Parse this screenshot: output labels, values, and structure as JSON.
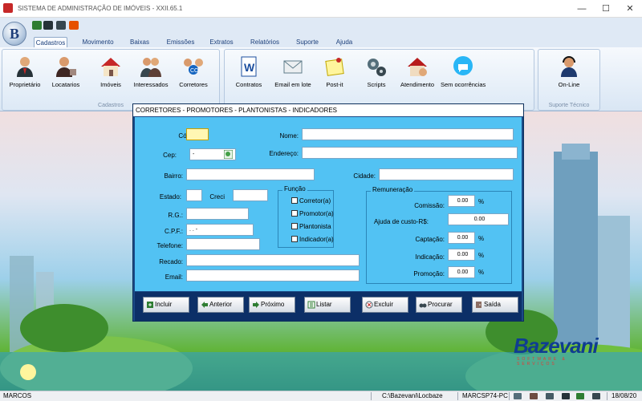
{
  "app": {
    "title": "SISTEMA DE ADMINISTRAÇÃO DE IMÓVEIS - XXII.65.1"
  },
  "window_controls": {
    "minimize": "—",
    "maximize": "☐",
    "close": "✕"
  },
  "menu_tabs": [
    "Cadastros",
    "Movimento",
    "Baixas",
    "Emissões",
    "Extratos",
    "Relatórios",
    "Suporte",
    "Ajuda"
  ],
  "ribbon": {
    "groups": {
      "cadastros": "Cadastros",
      "suporte": "Suporte Técnico"
    },
    "buttons": [
      "Proprietário",
      "Locatarios",
      "Imóveis",
      "Interessados",
      "Corretores",
      "Contratos",
      "Email em lote",
      "Post-it",
      "Scripts",
      "Atendimento",
      "Sem ocorrências",
      "On-Line"
    ]
  },
  "dialog": {
    "title": "CORRETORES - PROMOTORES - PLANTONISTAS - INDICADORES",
    "labels": {
      "codigo": "Código:",
      "nome": "Nome:",
      "cep": "Cep:",
      "endereco": "Endereço:",
      "bairro": "Bairro:",
      "cidade": "Cidade:",
      "estado": "Estado:",
      "creci": "Creci",
      "rg": "R.G.:",
      "cpf": "C.P.F.:",
      "telefone": "Telefone:",
      "recado": "Recado:",
      "email": "Email:"
    },
    "values": {
      "cep": "-",
      "cpf": ". . -"
    },
    "funcao": {
      "legend": "Função",
      "options": [
        "Corretor(a)",
        "Promotor(a)",
        "Plantonista",
        "Indicador(a)"
      ]
    },
    "remuneracao": {
      "legend": "Remuneração",
      "comissao_label": "Comissão:",
      "comissao": "0.00",
      "comissao_unit": "%",
      "ajuda_label": "Ajuda de custo-R$:",
      "ajuda": "0.00",
      "captacao_label": "Captação:",
      "captacao": "0.00",
      "captacao_unit": "%",
      "indicacao_label": "Indicação:",
      "indicacao": "0.00",
      "indicacao_unit": "%",
      "promocao_label": "Promoção:",
      "promocao": "0.00",
      "promocao_unit": "%"
    },
    "buttons": [
      "Incluir",
      "Anterior",
      "Próximo",
      "Listar",
      "Excluir",
      "Procurar",
      "Saída"
    ]
  },
  "brand": {
    "name": "Bazevani",
    "tagline": "SOFTWARE & SERVIÇOS"
  },
  "status": {
    "user": "MARCOS",
    "path": "C:\\Bazevani\\Locbaze",
    "machine": "MARCSP74-PC",
    "date": "18/08/20"
  }
}
